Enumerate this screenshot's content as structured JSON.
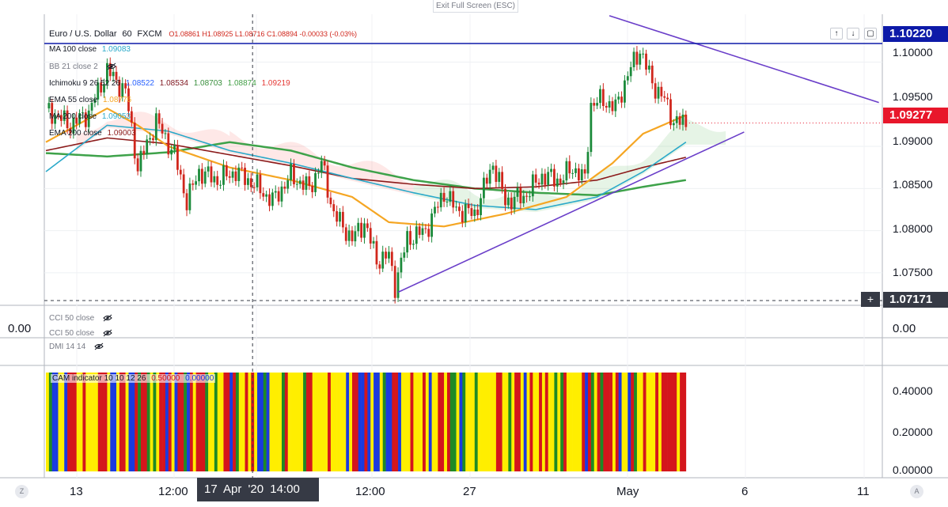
{
  "exit_fullscreen_label": "Exit Full Screen (ESC)",
  "header": {
    "symbol": "Euro / U.S. Dollar",
    "interval": "60",
    "exchange": "FXCM",
    "ohlc": "O1.08861 H1.08925 L1.08716 C1.08894 -0.00033 (-0.03%)"
  },
  "indicators": [
    {
      "label": "MA 100 close",
      "value": "1.09083",
      "color": "#2aa9c9"
    },
    {
      "label": "BB 21 close 2",
      "value": "",
      "color": ""
    },
    {
      "label": "Ichimoku 9 26 52 26",
      "values": [
        "1.08522",
        "1.08534",
        "1.08703",
        "1.08874",
        "1.09219"
      ],
      "colors": [
        "#2962ff",
        "#801922",
        "#388e3c",
        "#43a047",
        "#e53935"
      ]
    },
    {
      "label": "EMA 55 close",
      "value": "1.08776",
      "color": "#f5a623"
    },
    {
      "label": "MA 200 close",
      "value": "1.09053",
      "color": "#2aa9c9"
    },
    {
      "label": "EMA 200 close",
      "value": "1.09003",
      "color": "#8b1a1a"
    }
  ],
  "panes": {
    "cci1": "CCI 50 close",
    "cci2": "CCI 50 close",
    "dmi": "DMI 14 14",
    "cci_value": "0.00",
    "cam": {
      "label": "CAM indicator 10 10 12 26",
      "v1": "0.50000",
      "v2": "0.00000"
    }
  },
  "price_axis": {
    "ticks": [
      "1.10000",
      "1.09500",
      "1.09000",
      "1.08500",
      "1.08000",
      "1.07500"
    ],
    "current_price": "1.09277",
    "high_line": "1.10220",
    "crosshair_price": "1.07171",
    "cci_tick": "0.00",
    "cam_ticks": [
      "0.40000",
      "0.20000",
      "0.00000"
    ]
  },
  "time_axis": {
    "labels": [
      "13",
      "12:00",
      "12:00",
      "27",
      "May",
      "6",
      "11"
    ],
    "crosshair_time": "17 Apr '20  14:00",
    "left_corner": "Z",
    "right_corner": "A"
  },
  "colors": {
    "bull": "#1b8a3a",
    "bear": "#d0261c",
    "trendline": "#6a3ec9",
    "price_tag": "#e8172b",
    "high_tag": "#0d1aa8",
    "ema55": "#f5a623",
    "ma100": "#2aa9c9",
    "ema200": "#8b1a1a",
    "ma200": "#3ea24a",
    "cam": [
      "#ffee00",
      "#1a3ae0",
      "#d4161c",
      "#1e8a25"
    ]
  },
  "chart_data": {
    "type": "candlestick",
    "symbol": "EURUSD",
    "timeframe": "60",
    "ylim": [
      1.0705,
      1.1035
    ],
    "yticks": [
      1.075,
      1.08,
      1.085,
      1.09,
      1.095,
      1.1
    ],
    "x_labels": [
      "13",
      "12:00",
      "17 Apr '20",
      "12:00",
      "27",
      "May",
      "6",
      "11"
    ],
    "price_anchors": [
      {
        "t": 0,
        "p": 1.0945
      },
      {
        "t": 8,
        "p": 1.0925
      },
      {
        "t": 14,
        "p": 1.094
      },
      {
        "t": 20,
        "p": 1.099
      },
      {
        "t": 26,
        "p": 1.0965
      },
      {
        "t": 30,
        "p": 1.0875
      },
      {
        "t": 36,
        "p": 1.093
      },
      {
        "t": 42,
        "p": 1.089
      },
      {
        "t": 46,
        "p": 1.0835
      },
      {
        "t": 50,
        "p": 1.087
      },
      {
        "t": 56,
        "p": 1.086
      },
      {
        "t": 62,
        "p": 1.087
      },
      {
        "t": 68,
        "p": 1.0855
      },
      {
        "t": 74,
        "p": 1.0835
      },
      {
        "t": 80,
        "p": 1.0865
      },
      {
        "t": 86,
        "p": 1.085
      },
      {
        "t": 90,
        "p": 1.088
      },
      {
        "t": 94,
        "p": 1.082
      },
      {
        "t": 100,
        "p": 1.079
      },
      {
        "t": 104,
        "p": 1.081
      },
      {
        "t": 108,
        "p": 1.0765
      },
      {
        "t": 112,
        "p": 1.077
      },
      {
        "t": 114,
        "p": 1.0735
      },
      {
        "t": 118,
        "p": 1.079
      },
      {
        "t": 124,
        "p": 1.08
      },
      {
        "t": 130,
        "p": 1.0845
      },
      {
        "t": 134,
        "p": 1.0825
      },
      {
        "t": 140,
        "p": 1.082
      },
      {
        "t": 146,
        "p": 1.088
      },
      {
        "t": 150,
        "p": 1.0835
      },
      {
        "t": 156,
        "p": 1.084
      },
      {
        "t": 162,
        "p": 1.0865
      },
      {
        "t": 168,
        "p": 1.086
      },
      {
        "t": 172,
        "p": 1.0875
      },
      {
        "t": 176,
        "p": 1.086
      },
      {
        "t": 178,
        "p": 1.095
      },
      {
        "t": 182,
        "p": 1.0955
      },
      {
        "t": 186,
        "p": 1.0945
      },
      {
        "t": 190,
        "p": 1.0985
      },
      {
        "t": 194,
        "p": 1.1015
      },
      {
        "t": 198,
        "p": 1.0975
      },
      {
        "t": 202,
        "p": 1.0955
      },
      {
        "t": 205,
        "p": 1.093
      },
      {
        "t": 209,
        "p": 1.0927
      }
    ],
    "ema55": [
      [
        0,
        1.0905
      ],
      [
        20,
        1.0945
      ],
      [
        30,
        1.0925
      ],
      [
        40,
        1.09
      ],
      [
        60,
        1.0875
      ],
      [
        80,
        1.086
      ],
      [
        100,
        1.084
      ],
      [
        112,
        1.081
      ],
      [
        130,
        1.0805
      ],
      [
        150,
        1.082
      ],
      [
        170,
        1.084
      ],
      [
        185,
        1.088
      ],
      [
        195,
        1.0915
      ],
      [
        209,
        1.0937
      ]
    ],
    "ma100": [
      [
        0,
        1.087
      ],
      [
        20,
        1.0925
      ],
      [
        40,
        1.0918
      ],
      [
        60,
        1.0895
      ],
      [
        80,
        1.088
      ],
      [
        100,
        1.0862
      ],
      [
        120,
        1.0845
      ],
      [
        140,
        1.083
      ],
      [
        160,
        1.0825
      ],
      [
        180,
        1.084
      ],
      [
        195,
        1.087
      ],
      [
        209,
        1.0905
      ]
    ],
    "ema200": [
      [
        0,
        1.0895
      ],
      [
        20,
        1.091
      ],
      [
        40,
        1.0903
      ],
      [
        60,
        1.089
      ],
      [
        80,
        1.0877
      ],
      [
        100,
        1.0862
      ],
      [
        120,
        1.0855
      ],
      [
        140,
        1.085
      ],
      [
        160,
        1.0852
      ],
      [
        180,
        1.086
      ],
      [
        195,
        1.0875
      ],
      [
        209,
        1.0887
      ]
    ],
    "ma200": [
      [
        0,
        1.0892
      ],
      [
        20,
        1.0888
      ],
      [
        40,
        1.0893
      ],
      [
        60,
        1.0905
      ],
      [
        80,
        1.0895
      ],
      [
        100,
        1.0875
      ],
      [
        120,
        1.086
      ],
      [
        140,
        1.085
      ],
      [
        160,
        1.0845
      ],
      [
        180,
        1.0842
      ],
      [
        195,
        1.0852
      ],
      [
        209,
        1.086
      ]
    ],
    "trendlines": [
      {
        "from": [
          115,
          1.0727
        ],
        "to": [
          228,
          1.0917
        ]
      },
      {
        "from": [
          184,
          1.1055
        ],
        "to": [
          272,
          1.0952
        ]
      }
    ],
    "horizontal_lines": [
      {
        "price": 1.1022,
        "label": "1.10220"
      }
    ],
    "crosshair": {
      "t": 68,
      "price": 1.07171
    },
    "last_price": 1.09277,
    "cci": {
      "value": 0.0
    },
    "cam_indicator": {
      "ylim": [
        0,
        0.5
      ],
      "yticks": [
        0,
        0.2,
        0.4
      ],
      "bar_value": 0.5,
      "bars": 209
    }
  }
}
